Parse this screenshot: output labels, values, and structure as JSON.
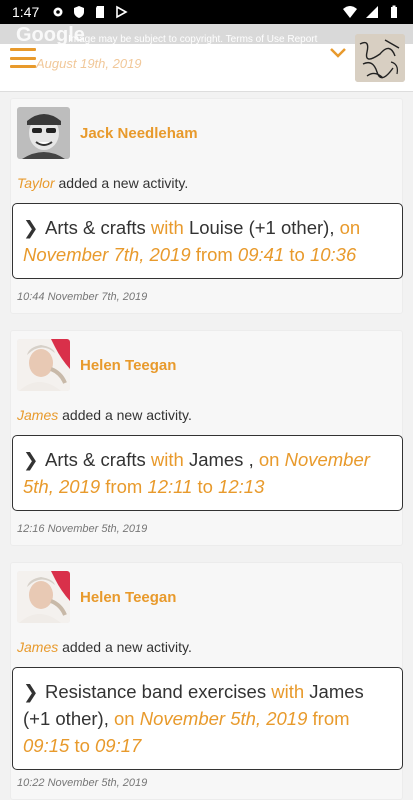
{
  "status_bar": {
    "time": "1:47",
    "left_icons": [
      "gear-icon",
      "shield-icon",
      "sd-card-icon",
      "play-icon"
    ],
    "right_icons": [
      "wifi-icon",
      "signal-icon",
      "battery-icon"
    ]
  },
  "header": {
    "banner_brand": "Google",
    "banner_notice": "Image may be subject to copyright.   Terms of Use   Report",
    "faded_date": "August 19th, 2019",
    "menu_icon": "hamburger-icon",
    "dropdown_icon": "chevron-down-icon"
  },
  "colors": {
    "accent": "#e89a2c",
    "text": "#333333",
    "background": "#f2f2f2"
  },
  "feed": [
    {
      "name": "Jack Needleham",
      "actor": "Taylor",
      "action": "added a new activity.",
      "activity_title": "Arts & crafts",
      "with_word": "with",
      "participants": "Louise (+1 other),",
      "on_word": "on",
      "date": "November 7th, 2019",
      "from_word": "from",
      "start": "09:41",
      "to_word": "to",
      "end": "10:36",
      "timestamp": "10:44 November 7th, 2019"
    },
    {
      "name": "Helen Teegan",
      "actor": "James",
      "action": "added a new activity.",
      "activity_title": "Arts & crafts",
      "with_word": "with",
      "participants": "James ,",
      "on_word": "on",
      "date": "November 5th, 2019",
      "from_word": "from",
      "start": "12:11",
      "to_word": "to",
      "end": "12:13",
      "timestamp": "12:16 November 5th, 2019"
    },
    {
      "name": "Helen Teegan",
      "actor": "James",
      "action": "added a new activity.",
      "activity_title": "Resistance band exercises",
      "with_word": "with",
      "participants": "James (+1 other),",
      "on_word": "on",
      "date": "November 5th, 2019",
      "from_word": "from",
      "start": "09:15",
      "to_word": "to",
      "end": "09:17",
      "timestamp": "10:22 November 5th, 2019"
    }
  ]
}
